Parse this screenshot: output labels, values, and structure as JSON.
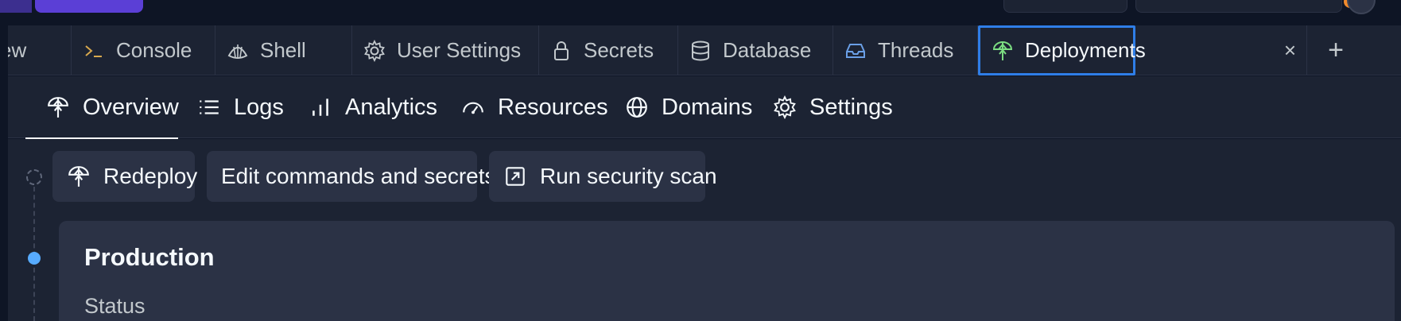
{
  "tabs": [
    {
      "label": "ew",
      "icon": "none"
    },
    {
      "label": "Console",
      "icon": "terminal-icon"
    },
    {
      "label": "Shell",
      "icon": "shell-icon"
    },
    {
      "label": "User Settings",
      "icon": "gear-icon"
    },
    {
      "label": "Secrets",
      "icon": "lock-icon"
    },
    {
      "label": "Database",
      "icon": "database-icon"
    },
    {
      "label": "Threads",
      "icon": "inbox-icon"
    },
    {
      "label": "Deployments",
      "icon": "deployments-icon",
      "active": true
    }
  ],
  "tab_close": "×",
  "tab_add": "+",
  "subnav": [
    {
      "label": "Overview",
      "icon": "deployments-icon",
      "active": true
    },
    {
      "label": "Logs",
      "icon": "list-icon"
    },
    {
      "label": "Analytics",
      "icon": "bar-chart-icon"
    },
    {
      "label": "Resources",
      "icon": "gauge-icon"
    },
    {
      "label": "Domains",
      "icon": "globe-icon"
    },
    {
      "label": "Settings",
      "icon": "gear-icon"
    }
  ],
  "actions": {
    "redeploy": "Redeploy",
    "edit": "Edit commands and secrets",
    "scan": "Run security scan"
  },
  "card": {
    "title": "Production",
    "status_label": "Status"
  },
  "colors": {
    "accent_blue": "#2f7ee8",
    "deploy_green": "#7bdc81",
    "timeline_dot": "#57abff",
    "console_orange": "#d8a94e"
  }
}
